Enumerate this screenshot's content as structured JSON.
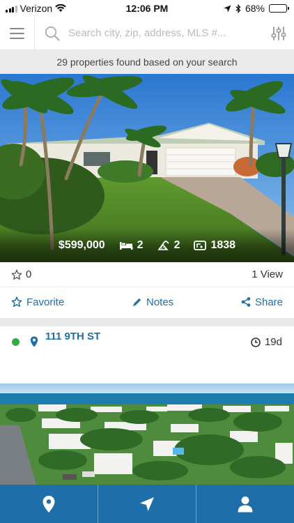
{
  "status_bar": {
    "carrier": "Verizon",
    "time": "12:06 PM",
    "battery": "68%",
    "battery_level": 0.68
  },
  "search": {
    "placeholder": "Search city, zip, address, MLS #..."
  },
  "results": {
    "text": "29 properties found based on your search"
  },
  "listing1": {
    "price": "$599,000",
    "beds": "2",
    "baths": "2",
    "sqft": "1838",
    "favorite_count": "0",
    "views": "1 View",
    "actions": {
      "favorite": "Favorite",
      "notes": "Notes",
      "share": "Share"
    }
  },
  "listing2": {
    "address": "111 9TH ST",
    "days_on_market": "19d",
    "status_color": "#2fae3e"
  },
  "colors": {
    "accent": "#1e6fa8",
    "nav_bg": "#1d6ea9"
  },
  "icons": {
    "menu": "hamburger-icon",
    "search": "search-icon",
    "filter": "sliders-icon",
    "beds": "bed-icon",
    "baths": "bath-icon",
    "sqft": "area-icon",
    "nav": [
      "location-pin-icon",
      "navigation-arrow-icon",
      "user-icon"
    ]
  }
}
